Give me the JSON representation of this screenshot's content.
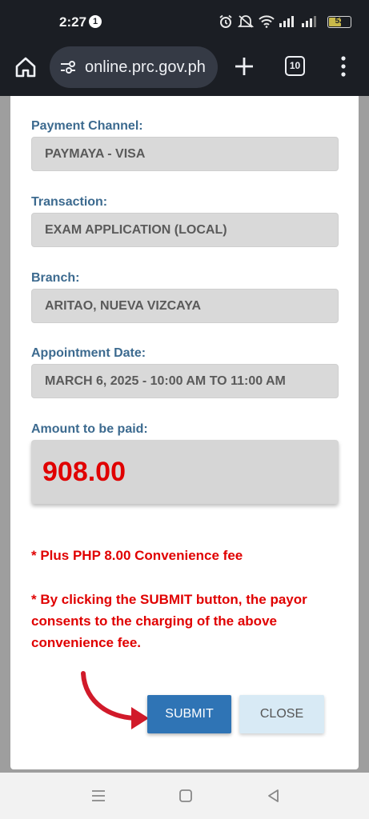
{
  "status_bar": {
    "time": "2:27",
    "notification_count": "1",
    "battery_level": "53"
  },
  "browser": {
    "url": "online.prc.gov.ph",
    "tab_count": "10"
  },
  "form": {
    "payment_channel_label": "Payment Channel:",
    "payment_channel_value": "PAYMAYA - VISA",
    "transaction_label": "Transaction:",
    "transaction_value": "EXAM APPLICATION (LOCAL)",
    "branch_label": "Branch:",
    "branch_value": "ARITAO, NUEVA VIZCAYA",
    "appointment_label": "Appointment Date:",
    "appointment_value": "MARCH 6, 2025 - 10:00 AM TO 11:00 AM",
    "amount_label": "Amount to be paid:",
    "amount_value": "908.00",
    "fee_note": "* Plus PHP 8.00 Convenience fee",
    "consent_note": "* By clicking the SUBMIT button, the payor consents to the charging of the above convenience fee.",
    "submit_label": "SUBMIT",
    "close_label": "CLOSE"
  },
  "colors": {
    "label": "#3c6a8f",
    "amount": "#e00000",
    "submit_bg": "#2f74b5",
    "close_bg": "#d8eaf5"
  },
  "icons": [
    "alarm-icon",
    "mute-icon",
    "wifi-icon",
    "signal-icon",
    "home-icon",
    "site-settings-icon",
    "plus-icon",
    "tab-switcher-icon",
    "more-vert-icon",
    "arrow-annotation",
    "recents-icon",
    "home-nav-icon",
    "back-icon"
  ]
}
